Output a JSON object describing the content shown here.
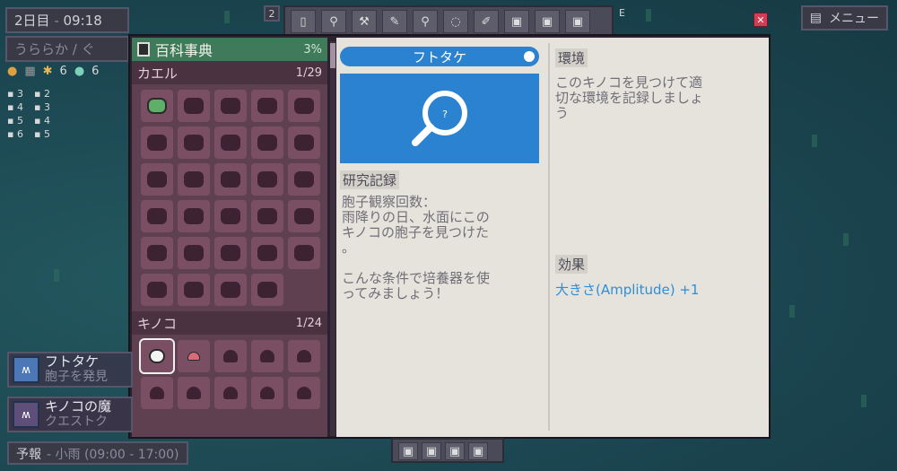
{
  "hud": {
    "day": "2日目",
    "time": "09:18",
    "weather": "うららか / ぐ",
    "resources": [
      "6",
      "6"
    ],
    "counts": [
      {
        "a": "3",
        "b": "2"
      },
      {
        "a": "4",
        "b": "3"
      },
      {
        "a": "5",
        "b": "4"
      },
      {
        "a": "6",
        "b": "5"
      }
    ]
  },
  "menu": {
    "label": "メニュー"
  },
  "toolbar": {
    "badge": "2",
    "badge_right": "E"
  },
  "encyclopedia": {
    "title": "百科事典",
    "percent": "3%",
    "categories": [
      {
        "name": "カエル",
        "count": "1/29"
      },
      {
        "name": "キノコ",
        "count": "1/24"
      }
    ]
  },
  "entry": {
    "name": "フトタケ",
    "image_symbol": "?",
    "env_label": "環境",
    "env_text": "このキノコを見つけて適\n切な環境を記録しましょ\nう",
    "research_label": "研究記録",
    "research_text": "胞子観察回数：\n雨降りの日、水面にこの\nキノコの胞子を見つけた\n。\n\nこんな条件で培養器を使\nってみましょう！",
    "effect_label": "効果",
    "effect_text": "大きさ(Amplitude) +1",
    "accent_color": "#2b82d1"
  },
  "quests": [
    {
      "title": "フトタケ",
      "sub": "胞子を発見"
    },
    {
      "title": "キノコの魔",
      "sub": "クエストク"
    }
  ],
  "forecast": {
    "label": "予報",
    "text": "- 小雨 (09:00 - 17:00)"
  }
}
